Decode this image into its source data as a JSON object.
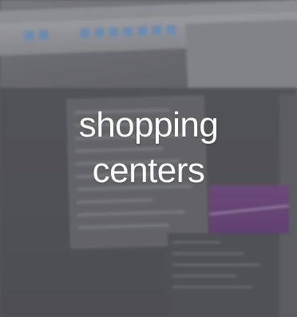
{
  "caption": {
    "line1": "shopping",
    "line2": "centers"
  },
  "colors": {
    "caption_text": "#ffffff",
    "background_tint": "#5e5e60",
    "viewport_accent": "#7a4c8e"
  }
}
